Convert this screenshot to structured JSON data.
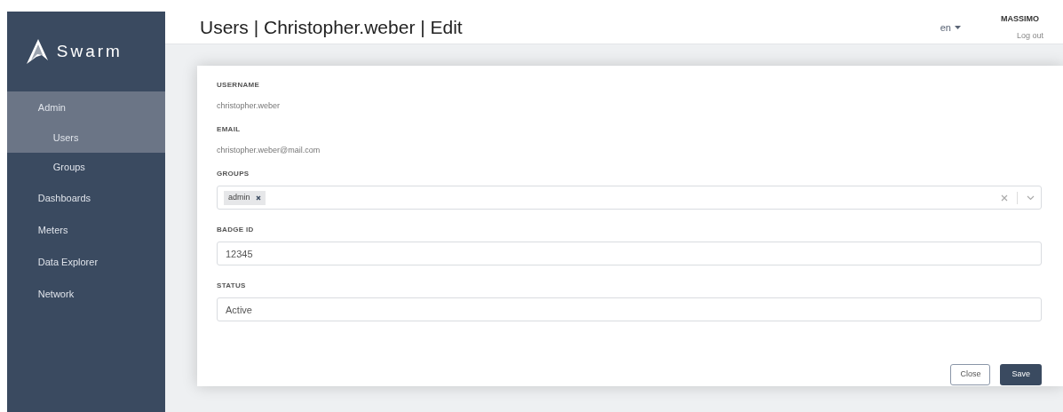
{
  "sidebar": {
    "brand": "Swarm",
    "items": [
      {
        "label": "Admin",
        "selected": true,
        "children": [
          {
            "label": "Users",
            "selected": true
          },
          {
            "label": "Groups",
            "selected": false
          }
        ]
      },
      {
        "label": "Dashboards",
        "selected": false
      },
      {
        "label": "Meters",
        "selected": false
      },
      {
        "label": "Data Explorer",
        "selected": false
      },
      {
        "label": "Network",
        "selected": false
      }
    ]
  },
  "header": {
    "title": "Users | Christopher.weber | Edit",
    "language": "en",
    "user": "MASSIMO",
    "logout": "Log out"
  },
  "form": {
    "fields": [
      {
        "kind": "text",
        "label": "USERNAME",
        "value": "christopher.weber"
      },
      {
        "kind": "text",
        "label": "EMAIL",
        "value": "christopher.weber@mail.com"
      },
      {
        "kind": "multiselect",
        "label": "GROUPS",
        "tags": [
          "admin"
        ]
      },
      {
        "kind": "input",
        "label": "BADGE ID",
        "value": "12345"
      },
      {
        "kind": "input",
        "label": "STATUS",
        "value": "Active"
      }
    ],
    "buttons": [
      {
        "label": "Close",
        "kind": "secondary"
      },
      {
        "label": "Save",
        "kind": "primary"
      }
    ]
  }
}
